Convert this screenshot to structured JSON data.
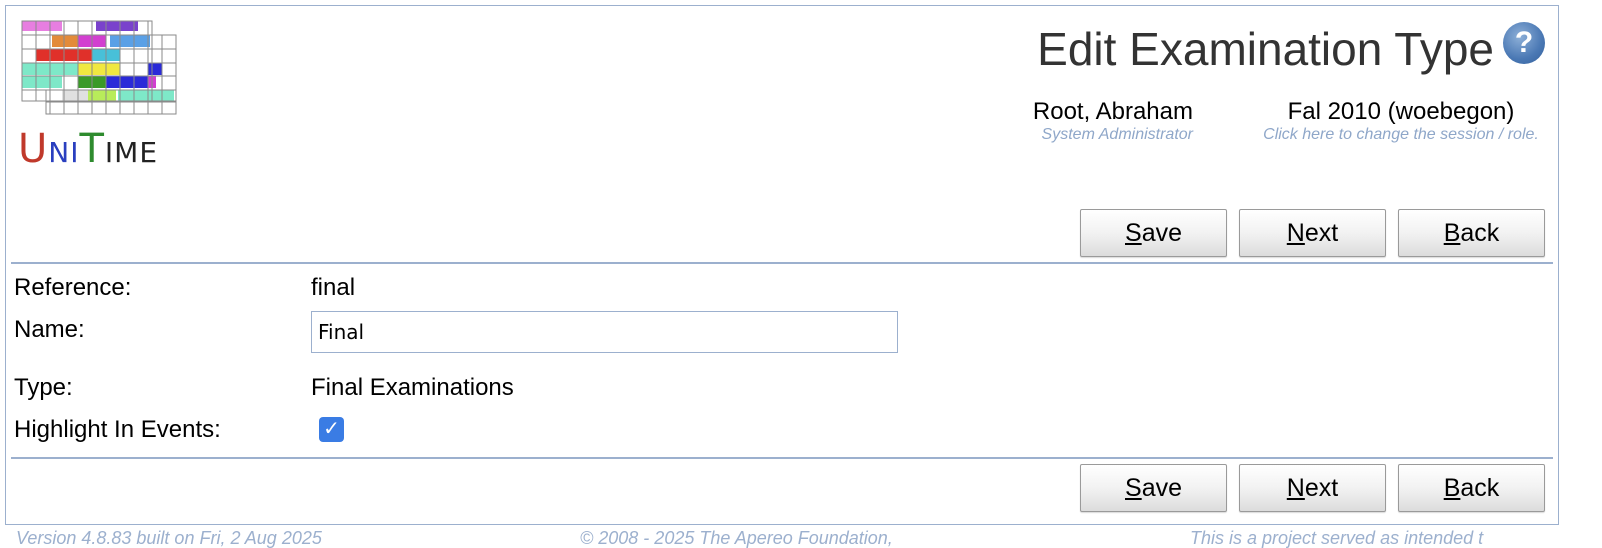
{
  "header": {
    "title": "Edit Examination Type",
    "help_icon": "question-mark-icon",
    "user_name": "Root, Abraham",
    "user_role": "System Administrator",
    "session_name": "Fal 2010 (woebegon)",
    "session_hint": "Click here to change the session / role."
  },
  "logo": {
    "text_u": "U",
    "text_ni": "NI",
    "text_t": "T",
    "text_ime": "IME"
  },
  "buttons": {
    "save_ul": "S",
    "save_rest": "ave",
    "next_ul": "N",
    "next_rest": "ext",
    "back_ul": "B",
    "back_rest": "ack"
  },
  "form": {
    "reference_label": "Reference:",
    "reference_value": "final",
    "name_label": "Name:",
    "name_value": "Final",
    "type_label": "Type:",
    "type_value": "Final Examinations",
    "highlight_label": "Highlight In Events:",
    "highlight_checked": true,
    "checkbox_glyph": "✓"
  },
  "footer": {
    "version": "Version 4.8.83 built on Fri, 2 Aug 2025",
    "copyright": "© 2008 - 2025 The Apereo Foundation,",
    "notice": "This is a project served as intended t"
  },
  "colors": {
    "accent_border": "#9cb0ce",
    "role_text": "#8fa7c9",
    "checkbox": "#3a7ce4",
    "logo_u": "#c0392b",
    "logo_ni": "#2a3fbf",
    "logo_t": "#2e8b2e"
  }
}
